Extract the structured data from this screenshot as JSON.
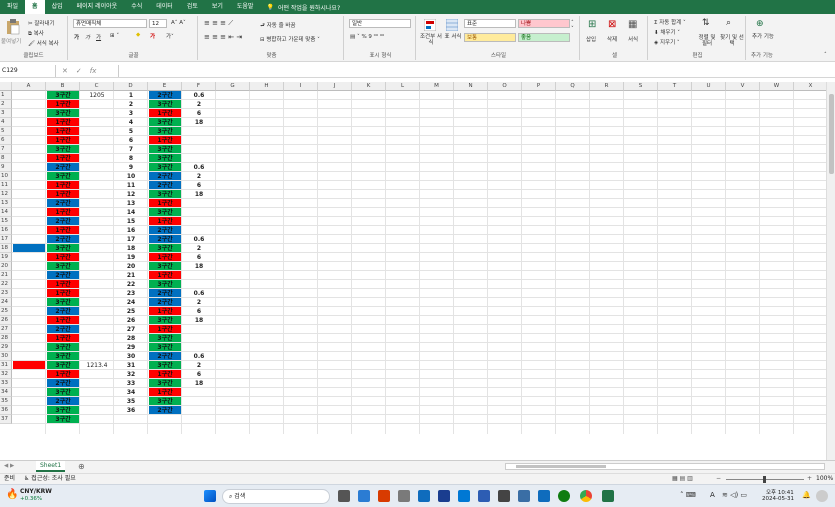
{
  "ribbon_tabs": [
    "파일",
    "홈",
    "삽입",
    "페이지 레이아웃",
    "수식",
    "데이터",
    "검토",
    "보기",
    "도움말"
  ],
  "active_tab_index": 1,
  "tell_me": "어떤 작업을 원하시나요?",
  "clipboard": {
    "paste": "붙여넣기",
    "cut": "잘라내기",
    "copy": "복사",
    "format_painter": "서식 복사",
    "label": "클립보드"
  },
  "font": {
    "name": "휴먼매직체",
    "size": "12",
    "bold": "가",
    "italic": "가",
    "underline": "가",
    "label": "글꼴"
  },
  "alignment": {
    "wrap": "자동 줄 바꿈",
    "merge": "병합하고 가운데 맞춤",
    "label": "맞춤"
  },
  "number": {
    "format": "일반",
    "label": "표시 형식"
  },
  "styles": {
    "conditional": "조건부 서식",
    "table": "표 서식",
    "normal": "표준",
    "bad": "나쁨",
    "neutral": "보통",
    "good": "좋음",
    "label": "스타일"
  },
  "cells": {
    "insert": "삽입",
    "delete": "삭제",
    "format": "서식",
    "label": "셀"
  },
  "editing": {
    "autosum": "자동 합계",
    "fill": "채우기",
    "clear": "지우기",
    "sort": "정렬 및 필터",
    "find": "찾기 및 선택",
    "label": "편집"
  },
  "addins": {
    "btn": "추가 기능",
    "label": "추가 기능"
  },
  "name_box": "C129",
  "columns": [
    "A",
    "B",
    "C",
    "D",
    "E",
    "F",
    "G",
    "H",
    "I",
    "J",
    "K",
    "L",
    "M",
    "N",
    "O",
    "P",
    "Q",
    "R",
    "S",
    "T",
    "U",
    "V",
    "W",
    "X"
  ],
  "rows": [
    {
      "n": "1",
      "b": "3구간",
      "bc": "g",
      "c": "1205",
      "d": "1",
      "e": "2구간",
      "ec": "b",
      "f": "0.6"
    },
    {
      "n": "2",
      "b": "1구간",
      "bc": "r",
      "c": "",
      "d": "2",
      "e": "3구간",
      "ec": "g",
      "f": "2"
    },
    {
      "n": "3",
      "b": "3구간",
      "bc": "g",
      "c": "",
      "d": "3",
      "e": "1구간",
      "ec": "r",
      "f": "6"
    },
    {
      "n": "4",
      "b": "1구간",
      "bc": "r",
      "c": "",
      "d": "4",
      "e": "3구간",
      "ec": "g",
      "f": "18"
    },
    {
      "n": "5",
      "b": "1구간",
      "bc": "r",
      "c": "",
      "d": "5",
      "e": "3구간",
      "ec": "g",
      "f": ""
    },
    {
      "n": "6",
      "b": "1구간",
      "bc": "r",
      "c": "",
      "d": "6",
      "e": "1구간",
      "ec": "r",
      "f": ""
    },
    {
      "n": "7",
      "b": "3구간",
      "bc": "g",
      "c": "",
      "d": "7",
      "e": "3구간",
      "ec": "g",
      "f": ""
    },
    {
      "n": "8",
      "b": "1구간",
      "bc": "r",
      "c": "",
      "d": "8",
      "e": "3구간",
      "ec": "g",
      "f": ""
    },
    {
      "n": "9",
      "b": "2구간",
      "bc": "b",
      "c": "",
      "d": "9",
      "e": "3구간",
      "ec": "g",
      "f": "0.6"
    },
    {
      "n": "10",
      "b": "3구간",
      "bc": "g",
      "c": "",
      "d": "10",
      "e": "2구간",
      "ec": "b",
      "f": "2"
    },
    {
      "n": "11",
      "b": "1구간",
      "bc": "r",
      "c": "",
      "d": "11",
      "e": "2구간",
      "ec": "b",
      "f": "6"
    },
    {
      "n": "12",
      "b": "1구간",
      "bc": "r",
      "c": "",
      "d": "12",
      "e": "3구간",
      "ec": "g",
      "f": "18"
    },
    {
      "n": "13",
      "b": "2구간",
      "bc": "b",
      "c": "",
      "d": "13",
      "e": "1구간",
      "ec": "r",
      "f": ""
    },
    {
      "n": "14",
      "b": "1구간",
      "bc": "r",
      "c": "",
      "d": "14",
      "e": "3구간",
      "ec": "g",
      "f": ""
    },
    {
      "n": "15",
      "b": "2구간",
      "bc": "b",
      "c": "",
      "d": "15",
      "e": "1구간",
      "ec": "r",
      "f": ""
    },
    {
      "n": "16",
      "b": "1구간",
      "bc": "r",
      "c": "",
      "d": "16",
      "e": "2구간",
      "ec": "b",
      "f": ""
    },
    {
      "n": "17",
      "b": "2구간",
      "bc": "b",
      "c": "",
      "d": "17",
      "e": "2구간",
      "ec": "b",
      "f": "0.6"
    },
    {
      "n": "18",
      "b": "3구간",
      "bc": "g",
      "c": "",
      "d": "18",
      "e": "3구간",
      "ec": "g",
      "f": "2",
      "a": "b"
    },
    {
      "n": "19",
      "b": "1구간",
      "bc": "r",
      "c": "",
      "d": "19",
      "e": "1구간",
      "ec": "r",
      "f": "6"
    },
    {
      "n": "20",
      "b": "3구간",
      "bc": "g",
      "c": "",
      "d": "20",
      "e": "3구간",
      "ec": "g",
      "f": "18"
    },
    {
      "n": "21",
      "b": "2구간",
      "bc": "b",
      "c": "",
      "d": "21",
      "e": "1구간",
      "ec": "r",
      "f": ""
    },
    {
      "n": "22",
      "b": "1구간",
      "bc": "r",
      "c": "",
      "d": "22",
      "e": "3구간",
      "ec": "g",
      "f": ""
    },
    {
      "n": "23",
      "b": "1구간",
      "bc": "r",
      "c": "",
      "d": "23",
      "e": "2구간",
      "ec": "b",
      "f": "0.6"
    },
    {
      "n": "24",
      "b": "3구간",
      "bc": "g",
      "c": "",
      "d": "24",
      "e": "2구간",
      "ec": "b",
      "f": "2"
    },
    {
      "n": "25",
      "b": "2구간",
      "bc": "b",
      "c": "",
      "d": "25",
      "e": "1구간",
      "ec": "r",
      "f": "6"
    },
    {
      "n": "26",
      "b": "1구간",
      "bc": "r",
      "c": "",
      "d": "26",
      "e": "3구간",
      "ec": "g",
      "f": "18"
    },
    {
      "n": "27",
      "b": "2구간",
      "bc": "b",
      "c": "",
      "d": "27",
      "e": "1구간",
      "ec": "r",
      "f": ""
    },
    {
      "n": "28",
      "b": "1구간",
      "bc": "r",
      "c": "",
      "d": "28",
      "e": "3구간",
      "ec": "g",
      "f": ""
    },
    {
      "n": "29",
      "b": "3구간",
      "bc": "g",
      "c": "",
      "d": "29",
      "e": "3구간",
      "ec": "g",
      "f": ""
    },
    {
      "n": "30",
      "b": "3구간",
      "bc": "g",
      "c": "",
      "d": "30",
      "e": "2구간",
      "ec": "b",
      "f": "0.6"
    },
    {
      "n": "31",
      "b": "3구간",
      "bc": "g",
      "c": "1213.4",
      "d": "31",
      "e": "3구간",
      "ec": "g",
      "f": "2",
      "a": "r"
    },
    {
      "n": "32",
      "b": "1구간",
      "bc": "r",
      "c": "",
      "d": "32",
      "e": "1구간",
      "ec": "r",
      "f": "6"
    },
    {
      "n": "33",
      "b": "2구간",
      "bc": "b",
      "c": "",
      "d": "33",
      "e": "3구간",
      "ec": "g",
      "f": "18"
    },
    {
      "n": "34",
      "b": "3구간",
      "bc": "g",
      "c": "",
      "d": "34",
      "e": "1구간",
      "ec": "r",
      "f": ""
    },
    {
      "n": "35",
      "b": "2구간",
      "bc": "b",
      "c": "",
      "d": "35",
      "e": "3구간",
      "ec": "g",
      "f": ""
    },
    {
      "n": "36",
      "b": "3구간",
      "bc": "g",
      "c": "",
      "d": "36",
      "e": "2구간",
      "ec": "b",
      "f": ""
    },
    {
      "n": "37",
      "b": "3구간",
      "bc": "g",
      "c": "",
      "d": "",
      "e": "",
      "ec": "",
      "f": ""
    }
  ],
  "colors": {
    "r": "#ff0000",
    "g": "#00b050",
    "b": "#0070c0",
    "excel": "#217346"
  },
  "sheet_tab": "Sheet1",
  "status": {
    "ready": "준비",
    "accessibility": "접근성: 조사 필요",
    "zoom": "100%"
  },
  "taskbar": {
    "ticker": "CNY/KRW",
    "change": "+0.36%",
    "search": "검색",
    "time": "오후 10:41",
    "date": "2024-05-31",
    "lang": "A"
  }
}
